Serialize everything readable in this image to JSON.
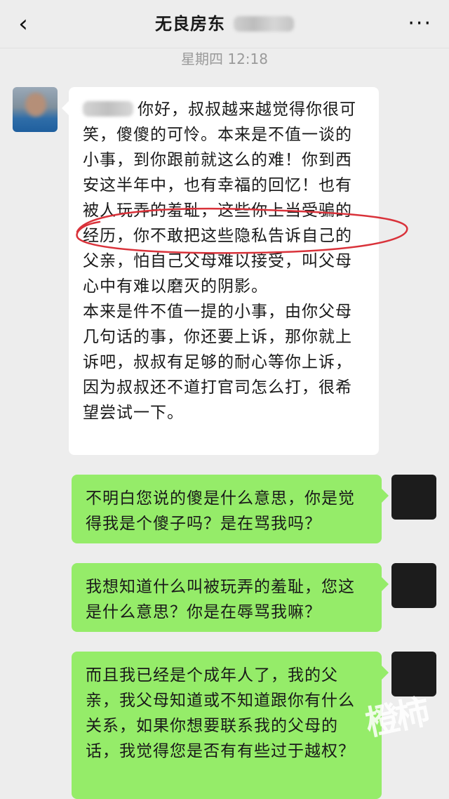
{
  "header": {
    "back_icon": "chevron-left-icon",
    "title": "无良房东",
    "more_icon": "more-dots-icon"
  },
  "timestamp": "星期四 12:18",
  "messages": [
    {
      "side": "incoming",
      "text": "你好，叔叔越来越觉得你很可笑，傻傻的可怜。本来是不值一谈的小事，到你跟前就这么的难！你到西安这半年中，也有幸福的回忆！也有被人玩弄的羞耻，这些你上当受骗的经历，你不敢把这些隐私告诉自己的父亲，怕自己父母难以接受，叫父母心中有难以磨灭的阴影。\n本来是件不值一提的小事，由你父母几句话的事，你还要上诉，那你就上诉吧，叔叔有足够的耐心等你上诉，因为叔叔还不道打官司怎么打，很希望尝试一下。"
    },
    {
      "side": "outgoing",
      "text": "不明白您说的傻是什么意思，你是觉得我是个傻子吗？是在骂我吗？"
    },
    {
      "side": "outgoing",
      "text": "我想知道什么叫被玩弄的羞耻，您这是什么意思？你是在辱骂我嘛？"
    },
    {
      "side": "outgoing",
      "text": "而且我已经是个成年人了，我的父亲，我父母知道或不知道跟你有什么关系，如果你想要联系我的父母的话，我觉得您是否有有些过于越权？"
    }
  ],
  "watermark": "橙柿",
  "colors": {
    "background": "#ededed",
    "incoming_bubble": "#ffffff",
    "outgoing_bubble": "#95ec69",
    "annotation_circle": "#d9323a"
  }
}
